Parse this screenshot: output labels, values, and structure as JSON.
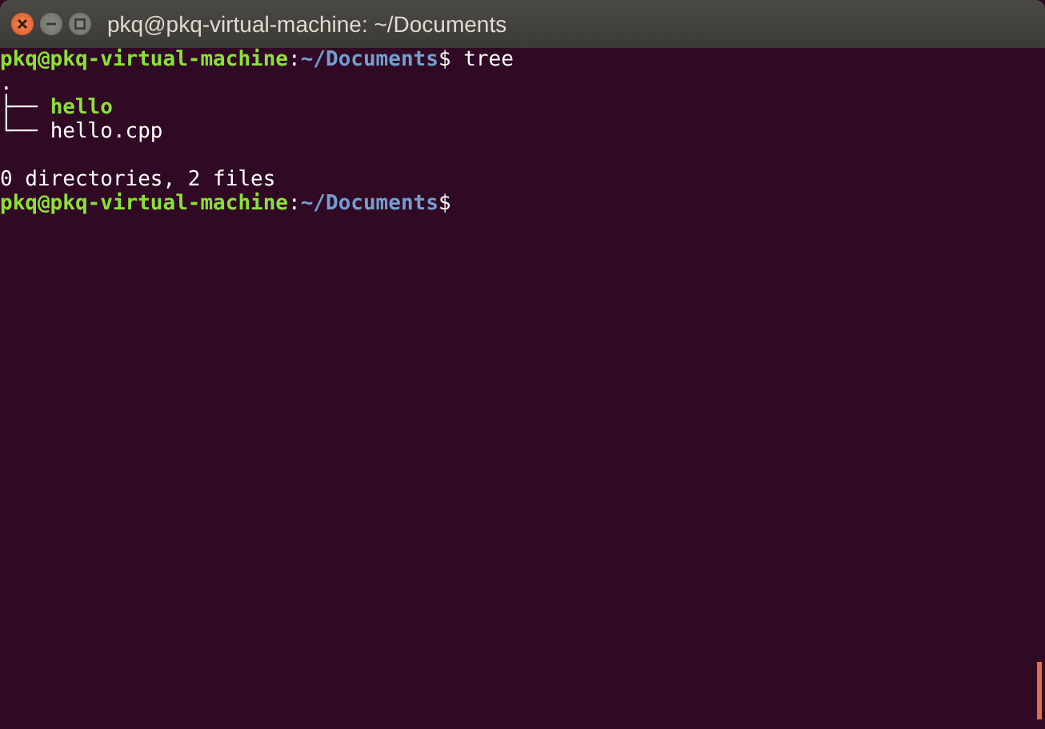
{
  "window": {
    "title": "pkq@pkq-virtual-machine: ~/Documents"
  },
  "lines": [
    {
      "kind": "prompt",
      "user_host": "pkq@pkq-virtual-machine",
      "separator": ":",
      "path": "~/Documents",
      "symbol": "$",
      "command": " tree"
    },
    {
      "kind": "output",
      "text": "."
    },
    {
      "kind": "tree",
      "branch": "├── ",
      "name": "hello",
      "executable": true
    },
    {
      "kind": "tree",
      "branch": "└── ",
      "name": "hello.cpp",
      "executable": false
    },
    {
      "kind": "blank"
    },
    {
      "kind": "output",
      "text": "0 directories, 2 files"
    },
    {
      "kind": "prompt",
      "user_host": "pkq@pkq-virtual-machine",
      "separator": ":",
      "path": "~/Documents",
      "symbol": "$"
    }
  ]
}
